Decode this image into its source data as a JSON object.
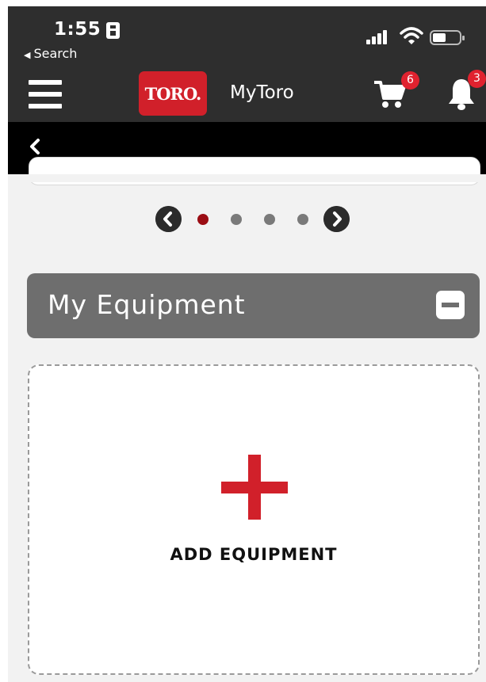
{
  "status_bar": {
    "time": "1:55",
    "back_app_label": "Search"
  },
  "header": {
    "logo_text": "TORO.",
    "title": "MyToro",
    "cart_count": "6",
    "notification_count": "3"
  },
  "carousel": {
    "page_count": 4,
    "active_index": 0,
    "active_color": "#9b0d14",
    "inactive_color": "#7a7a7a"
  },
  "equipment_section": {
    "title": "My Equipment",
    "add_label": "ADD EQUIPMENT"
  },
  "colors": {
    "brand_red": "#d1202a",
    "header_bg": "#2e2e2e",
    "nav_bg": "#000000",
    "section_bg": "#6e6e6e"
  },
  "icons": {
    "menu": "hamburger-menu-icon",
    "cart": "shopping-cart-icon",
    "bell": "notification-bell-icon",
    "back": "chevron-left-icon",
    "collapse": "minus-square-icon",
    "add": "plus-icon"
  }
}
